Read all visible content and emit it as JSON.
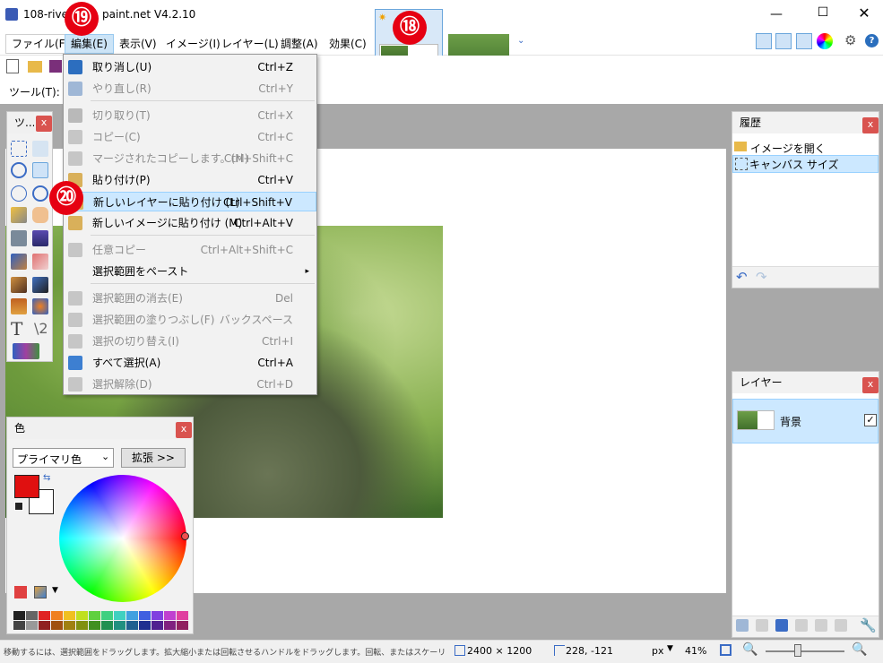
{
  "window": {
    "title": "108-river L…  – paint.net V4.2.10",
    "title_left": "108-rive",
    "title_right": "paint.net V4.2.10"
  },
  "menu": [
    "ファイル(F)",
    "編集(E)",
    "表示(V)",
    "イメージ(I)",
    "レイヤー(L)",
    "調整(A)",
    "効果(C)"
  ],
  "toolbar": {
    "tool_label": "ツール(T):"
  },
  "tools_panel": {
    "title": "ツ..."
  },
  "edit_menu": [
    {
      "label": "取り消し(U)",
      "shortcut": "Ctrl+Z",
      "disabled": false,
      "color": "#2c6ebf"
    },
    {
      "label": "やり直し(R)",
      "shortcut": "Ctrl+Y",
      "disabled": true,
      "color": "#9fb7d6"
    },
    {
      "label": "切り取り(T)",
      "shortcut": "Ctrl+X",
      "disabled": true,
      "color": "#b9b9b9"
    },
    {
      "label": "コピー(C)",
      "shortcut": "Ctrl+C",
      "disabled": true,
      "color": "#c6c6c6"
    },
    {
      "label": "マージされたコピーします。(M)",
      "shortcut": "Ctrl+Shift+C",
      "disabled": true,
      "color": "#c6c6c6"
    },
    {
      "label": "貼り付け(P)",
      "shortcut": "Ctrl+V",
      "disabled": false,
      "color": "#d9b05a"
    },
    {
      "label": "新しいレイヤーに貼り付け (L)",
      "shortcut": "Ctrl+Shift+V",
      "disabled": false,
      "color": "#d9b05a"
    },
    {
      "label": "新しいイメージに貼り付け (M)",
      "shortcut": "Ctrl+Alt+V",
      "disabled": false,
      "color": "#d9b05a"
    },
    {
      "label": "任意コピー",
      "shortcut": "Ctrl+Alt+Shift+C",
      "disabled": true,
      "color": "#c6c6c6"
    },
    {
      "label": "選択範囲をペースト",
      "shortcut": "▸",
      "disabled": false,
      "color": "transparent"
    },
    {
      "label": "選択範囲の消去(E)",
      "shortcut": "Del",
      "disabled": true,
      "color": "#c6c6c6"
    },
    {
      "label": "選択範囲の塗りつぶし(F)",
      "shortcut": "バックスペース",
      "disabled": true,
      "color": "#c6c6c6"
    },
    {
      "label": "選択の切り替え(I)",
      "shortcut": "Ctrl+I",
      "disabled": true,
      "color": "#c6c6c6"
    },
    {
      "label": "すべて選択(A)",
      "shortcut": "Ctrl+A",
      "disabled": false,
      "color": "#3d7fd1"
    },
    {
      "label": "選択解除(D)",
      "shortcut": "Ctrl+D",
      "disabled": true,
      "color": "#c6c6c6"
    }
  ],
  "history_panel": {
    "title": "履歴",
    "items": [
      "イメージを開く",
      "キャンバス サイズ"
    ]
  },
  "layers_panel": {
    "title": "レイヤー",
    "layer_name": "背景"
  },
  "colors_panel": {
    "title": "色",
    "mode": "プライマリ色",
    "expand": "拡張 >>",
    "primary": "#e01010"
  },
  "palette": [
    "#222222",
    "#666666",
    "#e02424",
    "#f08020",
    "#f0c020",
    "#c0e020",
    "#60d040",
    "#40d080",
    "#40d0c0",
    "#40a0e0",
    "#4060e0",
    "#8040e0",
    "#c040d0",
    "#e040a0",
    "#444444",
    "#999999",
    "#902020",
    "#a05010",
    "#a08010",
    "#809010",
    "#409020",
    "#209050",
    "#209080",
    "#206090",
    "#203090",
    "#502090",
    "#802080",
    "#902060"
  ],
  "annotations": [
    "⑲",
    "⑱",
    "⑳"
  ],
  "status": {
    "hint": "移動するには、選択範囲をドラッグします。拡大縮小または回転させるハンドルをドラッグします。回転、またはスケーリングを制約するには、shift キーを押し。",
    "size": "2400 × 1200",
    "coords": "228, -121",
    "unit": "px",
    "zoom": "41%"
  }
}
